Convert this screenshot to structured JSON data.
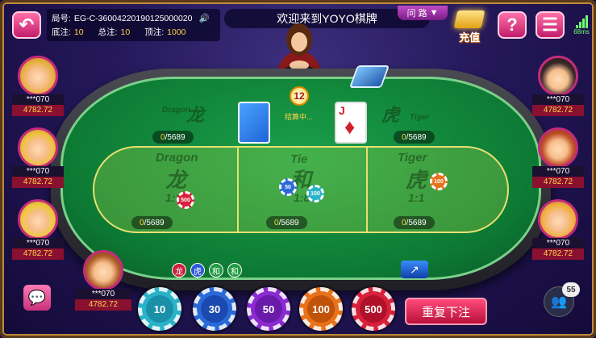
{
  "top": {
    "round_label": "局号:",
    "round_value": "EG-C-36004220190125000020",
    "bottom_label": "底注:",
    "bottom_value": "10",
    "total_label": "总注:",
    "total_value": "10",
    "topbet_label": "顶注:",
    "topbet_value": "1000",
    "title": "欢迎来到YOYO棋牌",
    "rules_label": "问 路",
    "recharge_label": "充值",
    "help_icon": "?",
    "latency": "68ms"
  },
  "table": {
    "dragon_top": "Dragon",
    "dragon_char": "龙",
    "tiger_top": "Tiger",
    "tiger_char": "虎",
    "dragon_count": "0",
    "tiger_count": "0",
    "limit": "/5689",
    "timer": "12",
    "status": "结算中...",
    "card_rank": "J",
    "card_suit": "♦",
    "zones": [
      {
        "en": "Dragon",
        "cn": "龙",
        "odds": "1:1",
        "count": "0",
        "limit": "/5689"
      },
      {
        "en": "Tie",
        "cn": "和",
        "odds": "1:8",
        "count": "0",
        "limit": "/5689"
      },
      {
        "en": "Tiger",
        "cn": "虎",
        "odds": "1:1",
        "count": "0",
        "limit": "/5689"
      }
    ],
    "history": [
      "龙",
      "虎",
      "和",
      "和"
    ]
  },
  "players_left": [
    {
      "name": "***070",
      "money": "4782.72"
    },
    {
      "name": "***070",
      "money": "4782.72"
    },
    {
      "name": "***070",
      "money": "4782.72"
    }
  ],
  "players_right": [
    {
      "name": "***070",
      "money": "4782.72"
    },
    {
      "name": "***070",
      "money": "4782.72"
    },
    {
      "name": "***070",
      "money": "4782.72"
    }
  ],
  "self": {
    "name": "***070",
    "money": "4782.72"
  },
  "chips": [
    {
      "value": "10",
      "color": "#2ab3c8"
    },
    {
      "value": "30",
      "color": "#2a6ad8"
    },
    {
      "value": "50",
      "color": "#8a2ad0"
    },
    {
      "value": "100",
      "color": "#e8721a"
    },
    {
      "value": "500",
      "color": "#d8203a"
    }
  ],
  "table_chips": [
    "500",
    "50",
    "100",
    "100"
  ],
  "rebet_label": "重复下注",
  "online_count": "55",
  "colors": {
    "felt": "#0d7a34",
    "accent": "#c21d6a",
    "gold": "#ffd54a"
  }
}
